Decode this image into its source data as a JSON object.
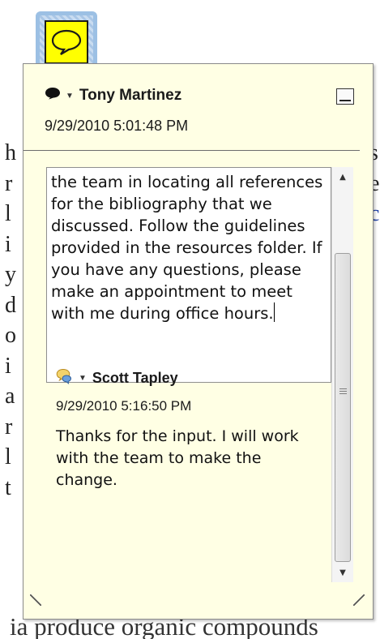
{
  "document": {
    "left_fragments": [
      "h",
      "r",
      "l",
      "i",
      "y",
      "d",
      "o",
      "i",
      "a",
      "r",
      "l",
      "t"
    ],
    "right_fragments": [
      "s",
      "e",
      "c",
      "",
      "",
      "",
      "",
      "",
      "",
      "",
      "",
      ""
    ],
    "bottom_line": "ia produce organic compounds"
  },
  "comment": {
    "author": "Tony Martinez",
    "timestamp": "9/29/2010 5:01:48 PM",
    "body": "the team in locating all references for the bibliography that we discussed. Follow the guidelines provided in the resources folder. If you have any questions, please make an appointment to meet with me during office hours."
  },
  "reply": {
    "author": "Scott Tapley",
    "timestamp": "9/29/2010 5:16:50 PM",
    "body": "Thanks for the input. I will work with the team to make the change."
  },
  "colors": {
    "note_icon": "#ffff00",
    "popup_background": "#ffffe4",
    "icon_frame": "#9cc0e4"
  },
  "icons": {
    "note": "speech-bubble-icon",
    "author": "comment-bubble-icon",
    "reply": "reply-bubble-icon",
    "minimize": "minimize-icon"
  }
}
